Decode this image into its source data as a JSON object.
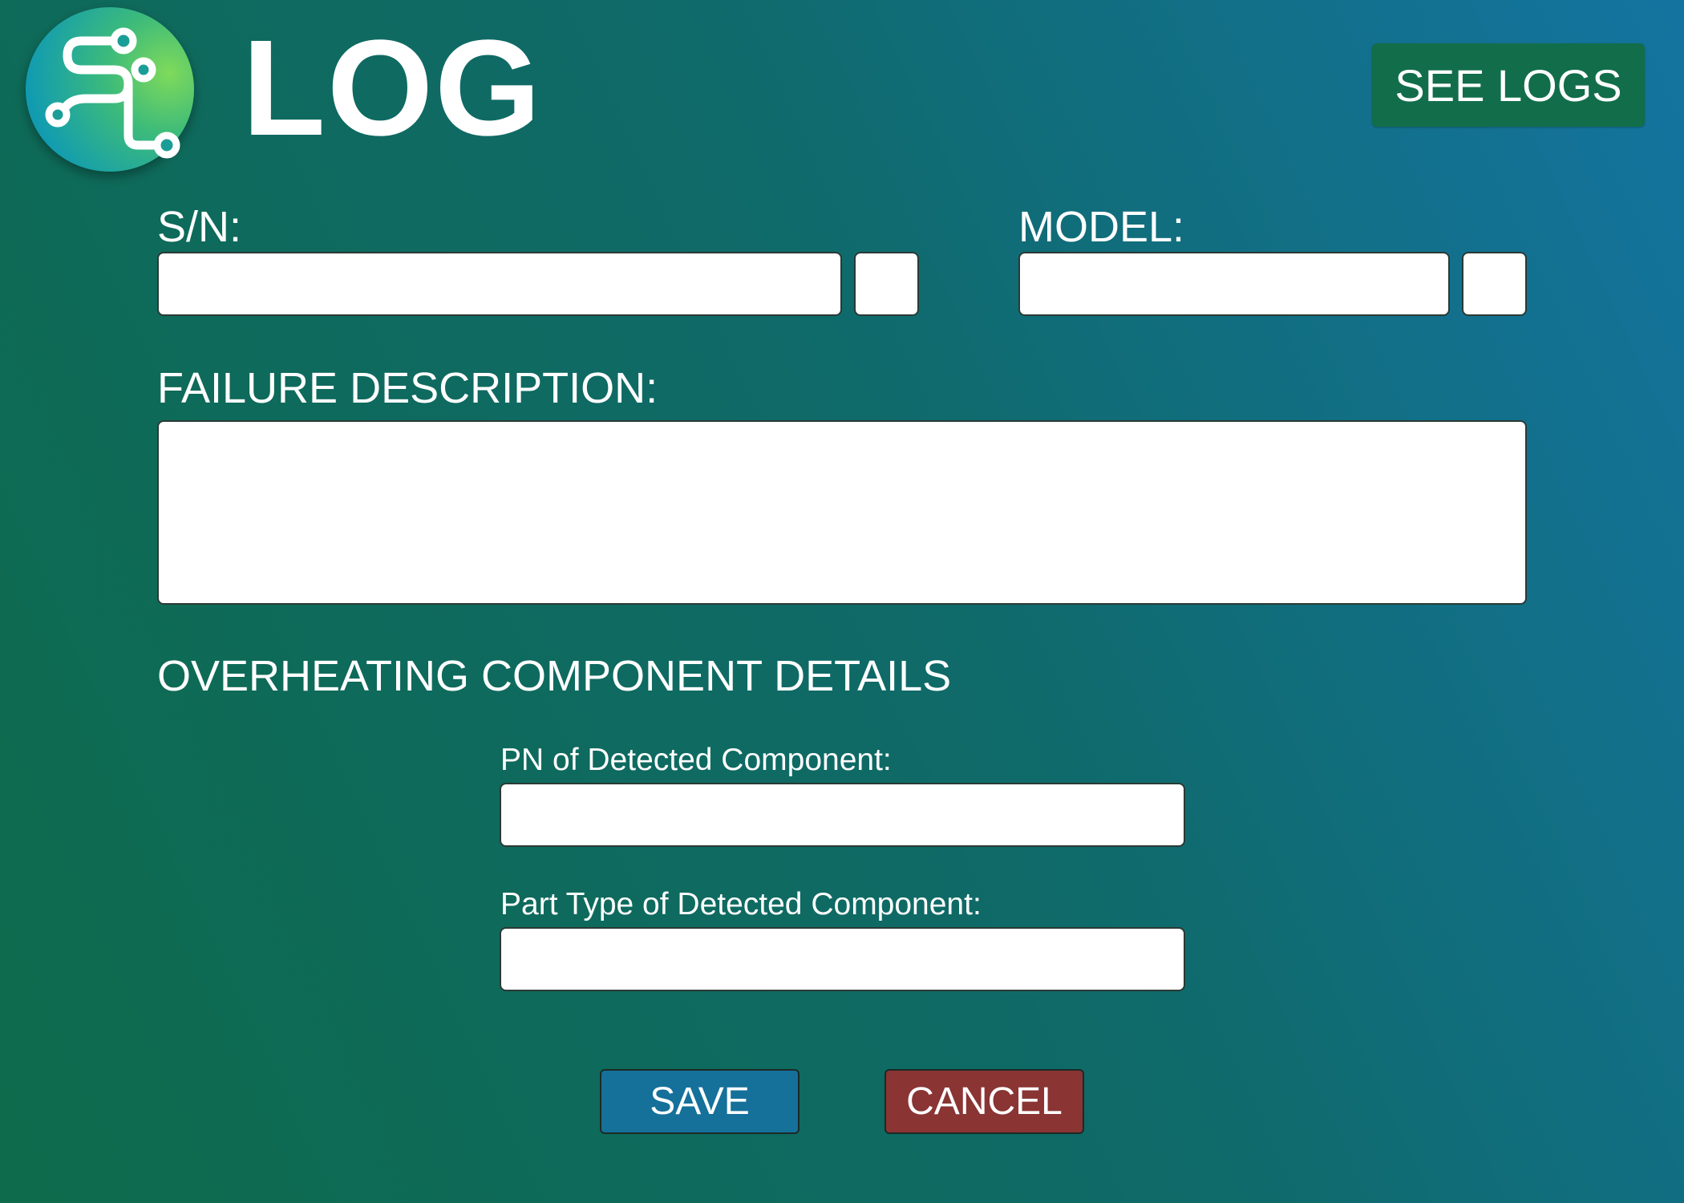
{
  "header": {
    "logo_icon": "flow-path-logo-icon",
    "title": "LOG",
    "see_logs_label": "SEE LOGS"
  },
  "form": {
    "sn": {
      "label": "S/N:",
      "value": "",
      "side_button": ""
    },
    "model": {
      "label": "MODEL:",
      "value": "",
      "side_button": ""
    },
    "failure_description": {
      "label": "FAILURE DESCRIPTION:",
      "value": ""
    },
    "section_title": "OVERHEATING COMPONENT DETAILS",
    "pn": {
      "label": "PN of Detected Component:",
      "value": ""
    },
    "part_type": {
      "label": "Part Type of Detected Component:",
      "value": ""
    }
  },
  "actions": {
    "save_label": "SAVE",
    "cancel_label": "CANCEL"
  },
  "colors": {
    "background_start": "#0e6b4b",
    "background_end": "#1474a0",
    "see_logs_bg": "#126e4a",
    "save_bg": "#15709a",
    "cancel_bg": "#8a3434"
  }
}
